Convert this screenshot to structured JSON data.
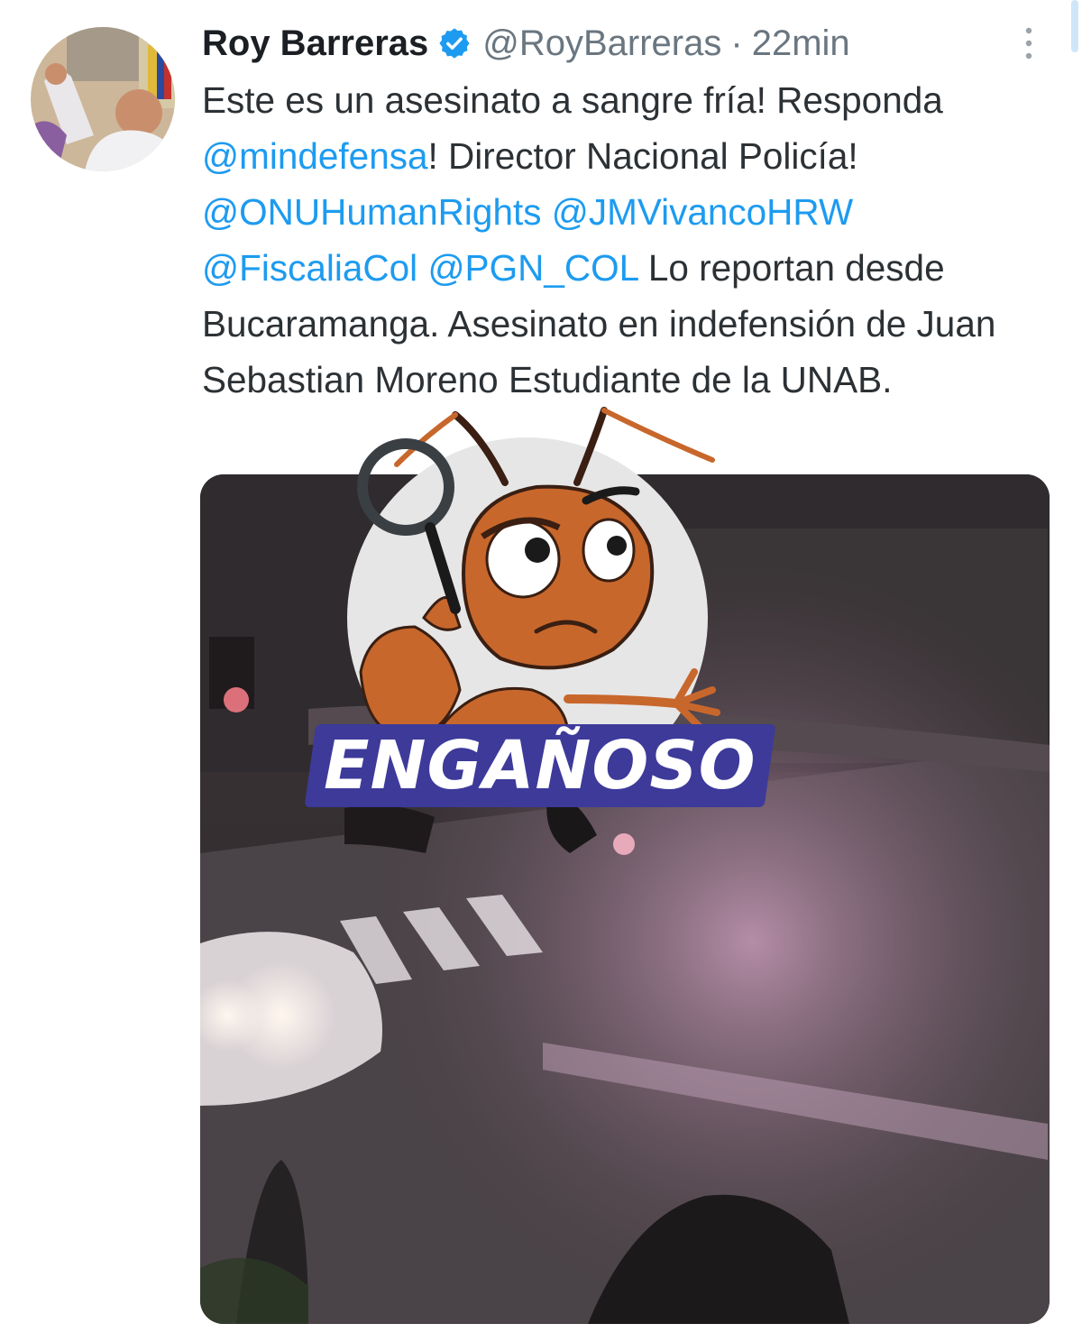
{
  "tweet": {
    "author_name": "Roy Barreras",
    "verified_icon": "verified-badge-icon",
    "handle": "@RoyBarreras",
    "separator": "·",
    "timestamp": "22min",
    "more_icon": "more-vertical-icon",
    "text_segments": [
      {
        "text": "Este es un asesinato a sangre fría! Responda ",
        "type": "text"
      },
      {
        "text": "@mindefensa",
        "type": "mention"
      },
      {
        "text": "! Director Nacional Policía! ",
        "type": "text"
      },
      {
        "text": "@ONUHumanRights",
        "type": "mention"
      },
      {
        "text": " ",
        "type": "text"
      },
      {
        "text": "@JMVivancoHRW",
        "type": "mention"
      },
      {
        "text": " ",
        "type": "text"
      },
      {
        "text": "@FiscaliaCol",
        "type": "mention"
      },
      {
        "text": " ",
        "type": "text"
      },
      {
        "text": "@PGN_COL",
        "type": "mention"
      },
      {
        "text": " Lo reportan desde Bucaramanga.  Asesinato en indefensión de Juan Sebastian Moreno Estudiante de la UNAB.",
        "type": "text"
      }
    ]
  },
  "overlay": {
    "mascot_icon": "ant-detective-icon",
    "magnifier_icon": "magnifying-glass-icon",
    "verdict_label": "ENGAÑOSO"
  },
  "colors": {
    "mention": "#1d9bf0",
    "verified": "#1d9bf0",
    "verdict_banner": "#3d3a9a",
    "ant_body": "#c8672c"
  }
}
